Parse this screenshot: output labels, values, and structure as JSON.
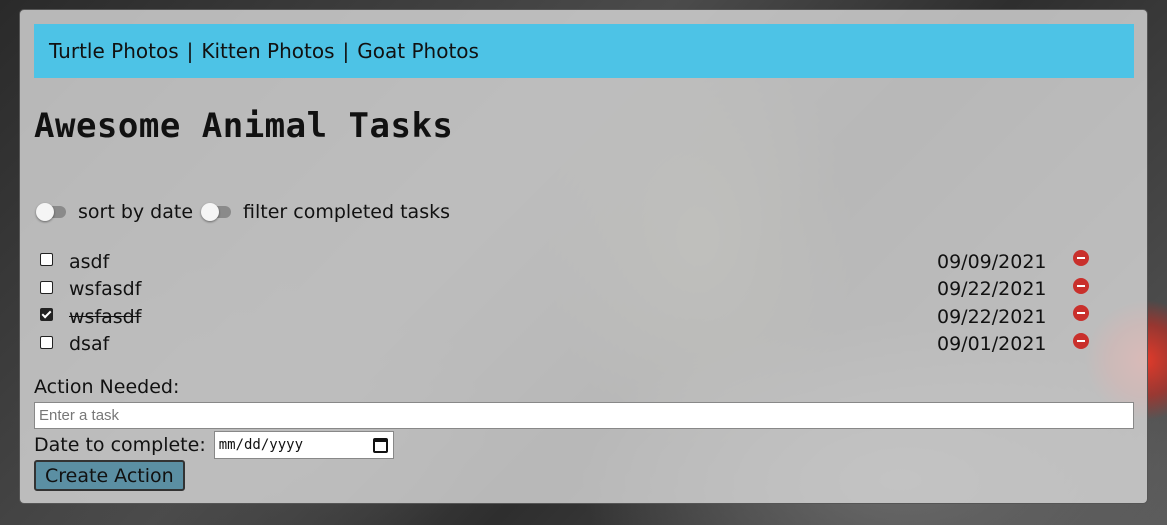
{
  "nav": {
    "links": [
      "Turtle Photos",
      "Kitten Photos",
      "Goat Photos"
    ],
    "separator": "|"
  },
  "page": {
    "title": "Awesome Animal Tasks"
  },
  "toggles": {
    "sort_label": "sort by date",
    "sort_on": false,
    "filter_label": "filter completed tasks",
    "filter_on": false
  },
  "tasks": [
    {
      "name": "asdf",
      "date": "09/09/2021",
      "completed": false
    },
    {
      "name": "wsfasdf",
      "date": "09/22/2021",
      "completed": false
    },
    {
      "name": "wsfasdf",
      "date": "09/22/2021",
      "completed": true
    },
    {
      "name": "dsaf",
      "date": "09/01/2021",
      "completed": false
    }
  ],
  "form": {
    "action_label": "Action Needed:",
    "task_placeholder": "Enter a task",
    "task_value": "",
    "date_label": "Date to complete:",
    "date_placeholder": "mm/dd/yyyy",
    "submit_label": "Create Action"
  },
  "colors": {
    "navbar": "#4dc3e6",
    "remove": "#c9302c",
    "button": "#5b8fa3"
  },
  "icons": {
    "remove": "remove-circle-icon",
    "calendar": "calendar-icon"
  }
}
